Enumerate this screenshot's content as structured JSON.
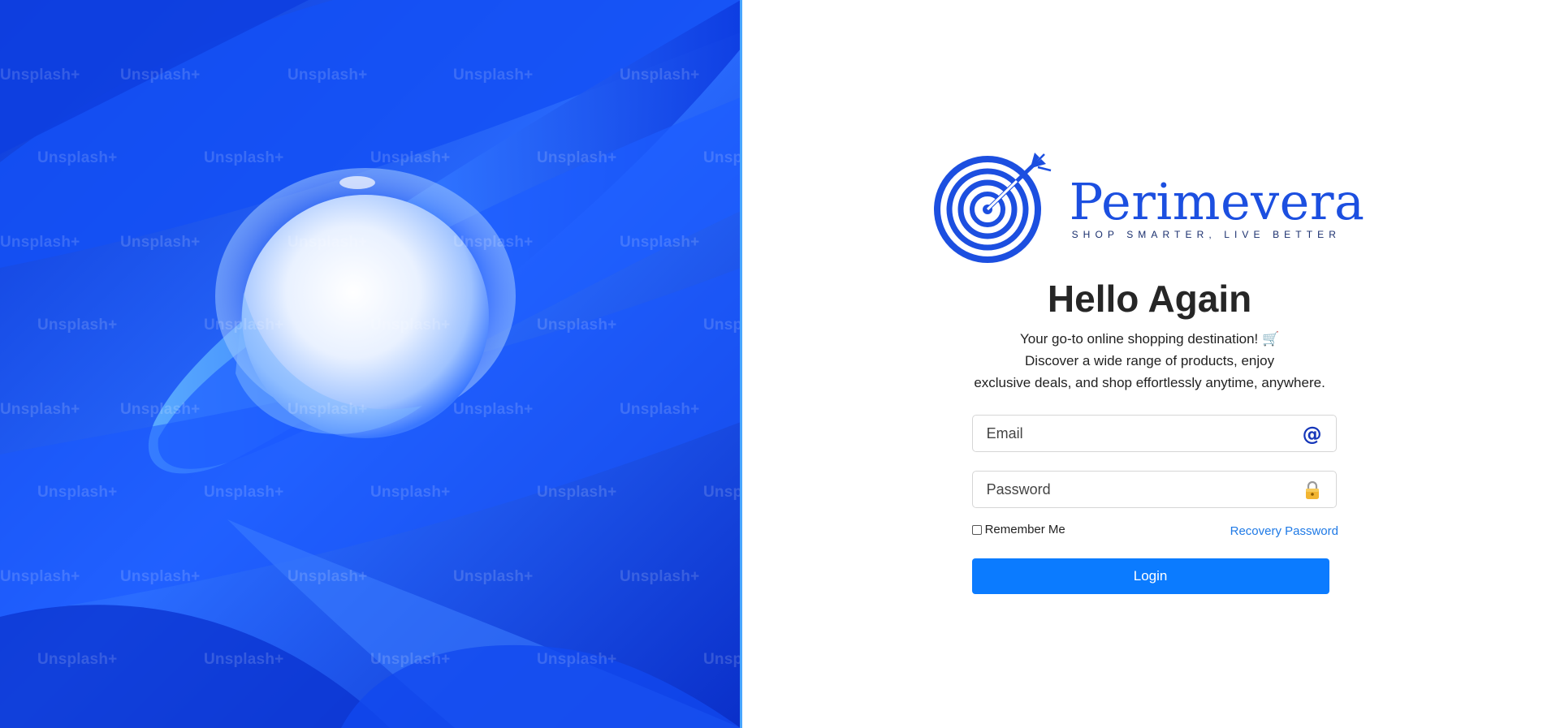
{
  "hero": {
    "watermark_text": "Unsplash+",
    "colors": {
      "primary_blue": "#0a3fe6",
      "light_blue": "#4aa8ff"
    }
  },
  "brand": {
    "name": "Perimevera",
    "tagline": "SHOP SMARTER, LIVE BETTER",
    "logo_icon": "target-arrow-icon",
    "color": "#1c4fe0"
  },
  "login": {
    "title": "Hello Again",
    "description_lines": [
      "Your go-to online shopping destination! 🛒",
      "Discover a wide range of products, enjoy",
      "exclusive deals, and shop effortlessly anytime, anywhere."
    ],
    "email": {
      "placeholder": "Email",
      "value": "",
      "icon": "at-sign-icon",
      "icon_glyph": "@"
    },
    "password": {
      "placeholder": "Password",
      "value": "",
      "icon": "lock-icon"
    },
    "remember_label": "Remember Me",
    "remember_checked": false,
    "recovery_label": "Recovery Password",
    "login_label": "Login",
    "accent_color": "#0b7bff",
    "link_color": "#1f7ae6"
  }
}
